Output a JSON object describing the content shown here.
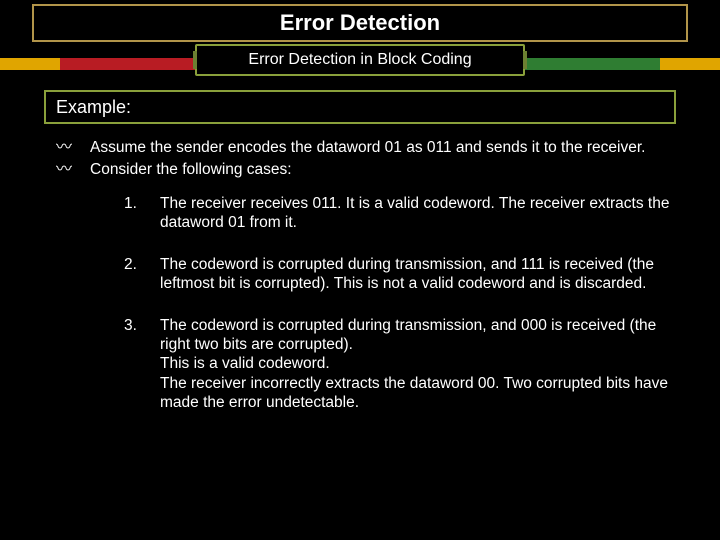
{
  "title": "Error Detection",
  "subtitle": "Error Detection in Block Coding",
  "example_label": "Example:",
  "bullets": [
    "Assume the sender encodes the dataword 01 as 011 and sends it to the receiver.",
    "Consider the following cases:"
  ],
  "cases": [
    {
      "num": "1.",
      "lines": [
        "The receiver receives 011. It is a valid codeword. The receiver extracts the dataword 01 from it."
      ]
    },
    {
      "num": "2.",
      "lines": [
        "The codeword is corrupted during transmission, and 111 is received (the leftmost bit is corrupted). This is not a valid codeword and is discarded."
      ]
    },
    {
      "num": "3.",
      "lines": [
        "The codeword is corrupted during transmission, and 000 is received (the right two bits are corrupted).",
        "This is a valid codeword.",
        "The receiver incorrectly extracts the dataword 00. Two corrupted bits have made the error undetectable."
      ]
    }
  ]
}
